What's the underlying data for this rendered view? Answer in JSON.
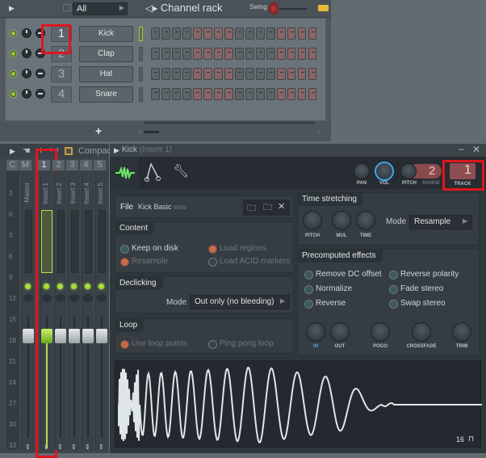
{
  "channel_rack": {
    "title": "Channel rack",
    "filter": "All",
    "swing_label": "Swing",
    "add_button": "+",
    "channels": [
      {
        "number": "1",
        "name": "Kick",
        "selected": true,
        "steps": [
          0,
          0,
          0,
          0,
          1,
          1,
          1,
          1,
          0,
          0,
          0,
          0,
          1,
          1,
          1,
          1
        ]
      },
      {
        "number": "2",
        "name": "Clap",
        "selected": false,
        "steps": [
          0,
          0,
          0,
          0,
          1,
          1,
          1,
          1,
          0,
          0,
          0,
          0,
          1,
          1,
          1,
          1
        ]
      },
      {
        "number": "3",
        "name": "Hat",
        "selected": false,
        "steps": [
          0,
          0,
          0,
          0,
          1,
          1,
          1,
          1,
          0,
          0,
          0,
          0,
          1,
          1,
          1,
          1
        ]
      },
      {
        "number": "4",
        "name": "Snare",
        "selected": false,
        "steps": [
          0,
          0,
          0,
          0,
          1,
          1,
          1,
          1,
          0,
          0,
          0,
          0,
          1,
          1,
          1,
          1
        ]
      }
    ]
  },
  "mixer": {
    "view_label": "Compac",
    "headers": [
      "C",
      "M",
      "1",
      "2",
      "3",
      "4",
      "5"
    ],
    "tracks": [
      "Master",
      "Insert 1",
      "Insert 2",
      "Insert 3",
      "Insert 4",
      "Insert 5"
    ],
    "selected_track": "Insert 1",
    "db_scale": [
      "3",
      "0",
      "3",
      "6",
      "9",
      "12",
      "15",
      "18",
      "21",
      "24",
      "27",
      "30",
      "33"
    ]
  },
  "channel_settings": {
    "title": "Kick",
    "subtitle": "(Insert 1)",
    "knobs": {
      "pan": "PAN",
      "vol": "VOL",
      "pitch": "PITCH",
      "range": "RANGE"
    },
    "range_value": "2",
    "track_value": "1",
    "track_label": "TRACK",
    "file_label": "File",
    "file_name": "Kick Basic",
    "file_ext": "wav",
    "content": {
      "title": "Content",
      "keep_on_disk": "Keep on disk",
      "resample": "Resample",
      "load_regions": "Load regions",
      "load_acid": "Load ACID markers"
    },
    "declicking": {
      "title": "Declicking",
      "mode_label": "Mode",
      "mode_value": "Out only (no bleeding)"
    },
    "loop": {
      "title": "Loop",
      "use_loop_points": "Use loop points",
      "ping_pong": "Ping pong loop"
    },
    "time_stretching": {
      "title": "Time stretching",
      "knobs": [
        "PITCH",
        "MUL",
        "TIME"
      ],
      "mode_label": "Mode",
      "mode_value": "Resample"
    },
    "precomputed": {
      "title": "Precomputed effects",
      "options": [
        "Remove DC offset",
        "Reverse polarity",
        "Normalize",
        "Fade stereo",
        "Reverse",
        "Swap stereo"
      ],
      "knobs": [
        "IN",
        "OUT",
        "POGO",
        "CROSSFADE",
        "TRIM"
      ]
    },
    "waveform_resolution": "16"
  },
  "colors": {
    "accent_green": "#9ccc3c",
    "highlight_red": "#e0161f",
    "step_on": "#8a6565"
  }
}
